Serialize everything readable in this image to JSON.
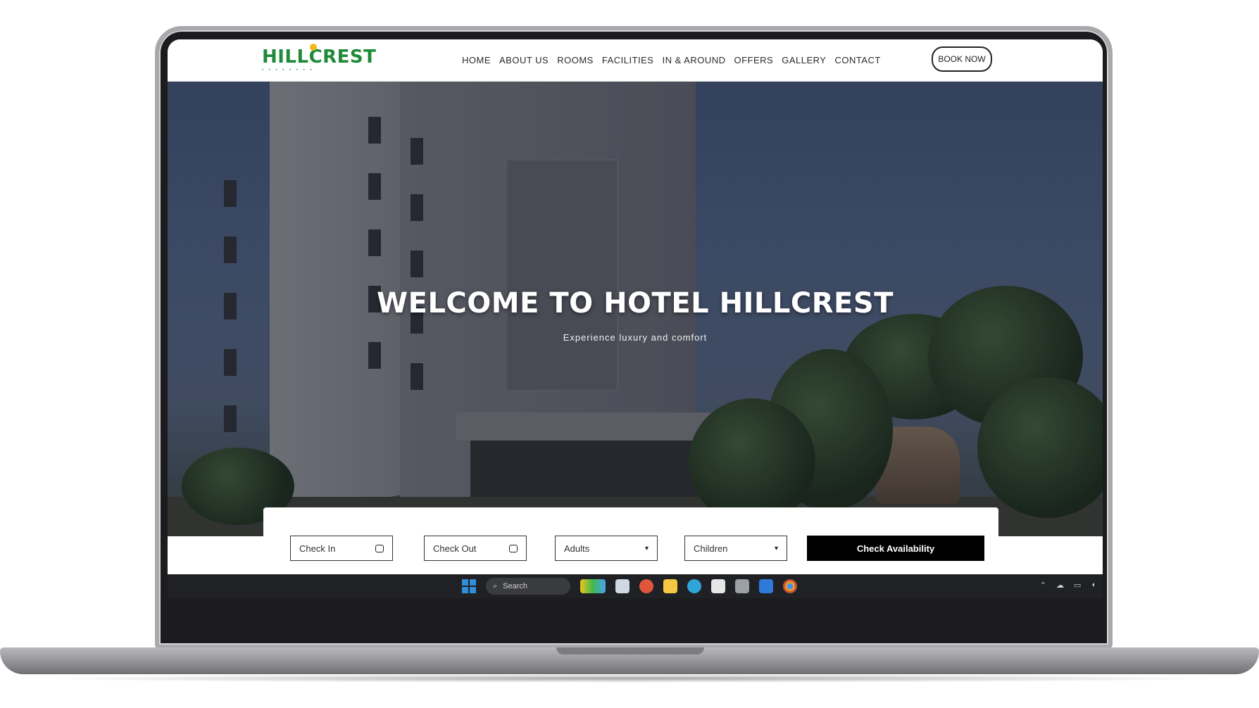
{
  "site": {
    "logo_text": "HILLCREST",
    "nav_items": [
      "HOME",
      "ABOUT US",
      "ROOMS",
      "FACILITIES",
      "IN & AROUND",
      "OFFERS",
      "GALLERY",
      "CONTACT"
    ],
    "book_button": "BOOK NOW"
  },
  "hero": {
    "title": "WELCOME TO HOTEL HILLCREST",
    "subtitle": "Experience luxury and comfort"
  },
  "booking": {
    "check_in": "Check In",
    "check_out": "Check Out",
    "adults": "Adults",
    "children": "Children",
    "submit": "Check Availability"
  },
  "taskbar": {
    "search_label": "Search"
  },
  "colors": {
    "brand_green": "#1f8a3a",
    "accent_yellow": "#f2b81c",
    "button_black": "#000000"
  }
}
